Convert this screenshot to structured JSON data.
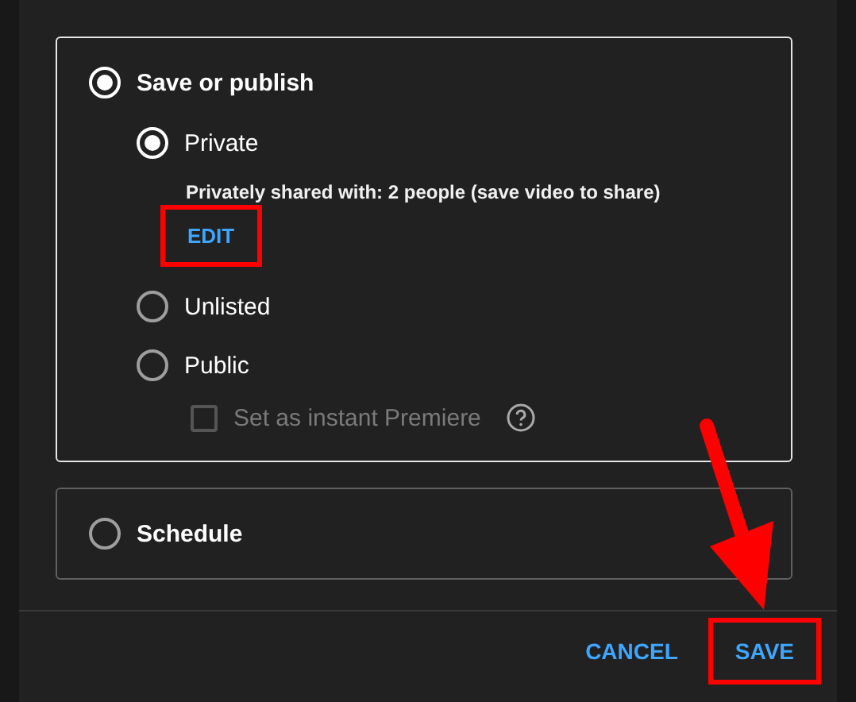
{
  "visibility": {
    "label": "Save or publish",
    "selected": true,
    "options": [
      {
        "label": "Private",
        "selected": true,
        "note": "Privately shared with: 2 people (save video to share)",
        "action": {
          "label": "EDIT",
          "highlighted": true
        }
      },
      {
        "label": "Unlisted",
        "selected": false
      },
      {
        "label": "Public",
        "selected": false,
        "premiere": {
          "label": "Set as instant Premiere",
          "checked": false,
          "disabled": true
        }
      }
    ]
  },
  "schedule": {
    "label": "Schedule",
    "selected": false
  },
  "buttons": [
    {
      "label": "CANCEL",
      "highlighted": false
    },
    {
      "label": "SAVE",
      "highlighted": true
    }
  ]
}
